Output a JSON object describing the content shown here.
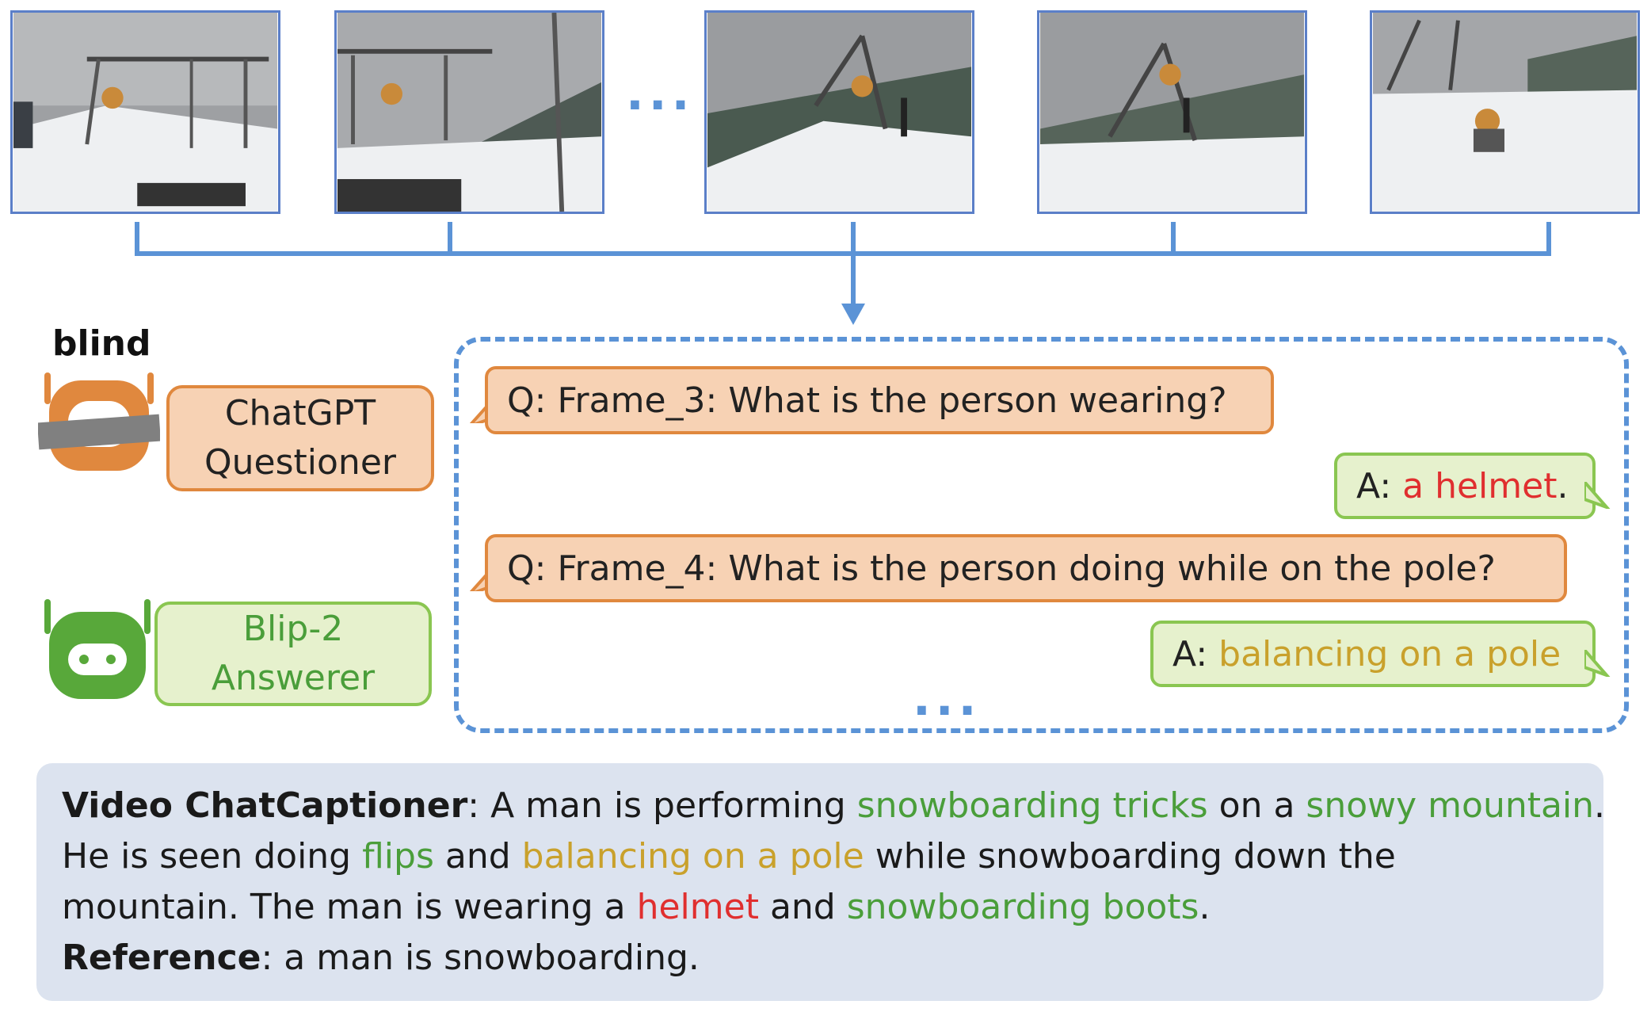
{
  "frames": {
    "ellipsis": "...",
    "items": [
      {
        "name": "frame-1"
      },
      {
        "name": "frame-2"
      },
      {
        "name": "frame-3"
      },
      {
        "name": "frame-4"
      },
      {
        "name": "frame-5"
      }
    ]
  },
  "questioner": {
    "blind_label": "blind",
    "line1": "ChatGPT",
    "line2": "Questioner",
    "icon": "blindfolded-robot-icon"
  },
  "answerer": {
    "line1": "Blip-2",
    "line2": "Answerer",
    "icon": "robot-icon"
  },
  "dialog": {
    "q1": "Q: Frame_3: What is the person wearing?",
    "a1_prefix": "A: ",
    "a1_highlight": "a helmet",
    "a1_suffix": ".",
    "q2": "Q: Frame_4: What is the person doing while on the pole?",
    "a2_prefix": "A: ",
    "a2_highlight": "balancing on a pole",
    "ellipsis": "..."
  },
  "summary": {
    "caption_label": "Video ChatCaptioner",
    "t1": ": A man is performing ",
    "h1": "snowboarding tricks",
    "t2": " on a ",
    "h2": "snowy mountain",
    "t3": ".",
    "t4": "He is seen doing ",
    "h3": "flips",
    "t5": " and ",
    "h4": "balancing on a pole",
    "t6": " while snowboarding down the",
    "t7": "mountain. The man is wearing a ",
    "h5": "helmet",
    "t8": " and ",
    "h6": "snowboarding boots",
    "t9": ".",
    "reference_label": "Reference",
    "reference_text": ": a man is snowboarding."
  },
  "colors": {
    "blue": "#5b93d6",
    "orange_fill": "#f7d2b4",
    "orange_border": "#e0883e",
    "green_fill": "#e6f1cd",
    "green_border": "#8ac651",
    "red_highlight": "#e02f2f",
    "green_highlight": "#4a9e3a",
    "gold_highlight": "#c9a12c",
    "summary_bg": "#dce3ef"
  }
}
